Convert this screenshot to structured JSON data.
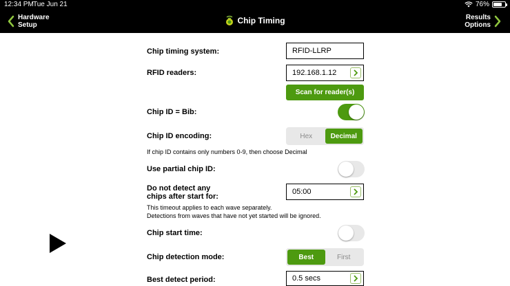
{
  "status_bar": {
    "time": "12:34 PM",
    "date": "Tue Jun 21",
    "battery": "76%",
    "battery_level": 0.76
  },
  "nav": {
    "back_line1": "Hardware",
    "back_line2": "Setup",
    "title": "Chip Timing",
    "forward_line1": "Results",
    "forward_line2": "Options"
  },
  "form": {
    "chip_timing_system": {
      "label": "Chip timing system:",
      "value": "RFID-LLRP"
    },
    "rfid_readers": {
      "label": "RFID readers:",
      "value": "192.168.1.12",
      "scan_button": "Scan for reader(s)"
    },
    "chip_id_bib": {
      "label": "Chip ID = Bib:",
      "on": true
    },
    "chip_id_encoding": {
      "label": "Chip ID encoding:",
      "options": [
        "Hex",
        "Decimal"
      ],
      "selected": "Decimal",
      "hint": "If chip ID contains only numbers 0-9, then choose Decimal"
    },
    "partial_chip_id": {
      "label": "Use partial chip ID:",
      "on": false
    },
    "no_detect": {
      "label_line1": "Do not detect any",
      "label_line2": "chips after start for:",
      "value": "05:00",
      "hint_line1": "This timeout applies to each wave separately.",
      "hint_line2": "Detections from waves that have not yet started will be ignored."
    },
    "chip_start_time": {
      "label": "Chip start time:",
      "on": false
    },
    "detection_mode": {
      "label": "Chip detection mode:",
      "options": [
        "Best",
        "First"
      ],
      "selected": "Best"
    },
    "best_detect_period": {
      "label": "Best detect period:",
      "value": "0.5 secs"
    }
  },
  "colors": {
    "accent": "#4d9a10",
    "bar": "#000000",
    "toggle_off": "#e8e8e8"
  },
  "icons": {
    "play": "play-icon",
    "logo": "chip-timing-logo-icon"
  }
}
